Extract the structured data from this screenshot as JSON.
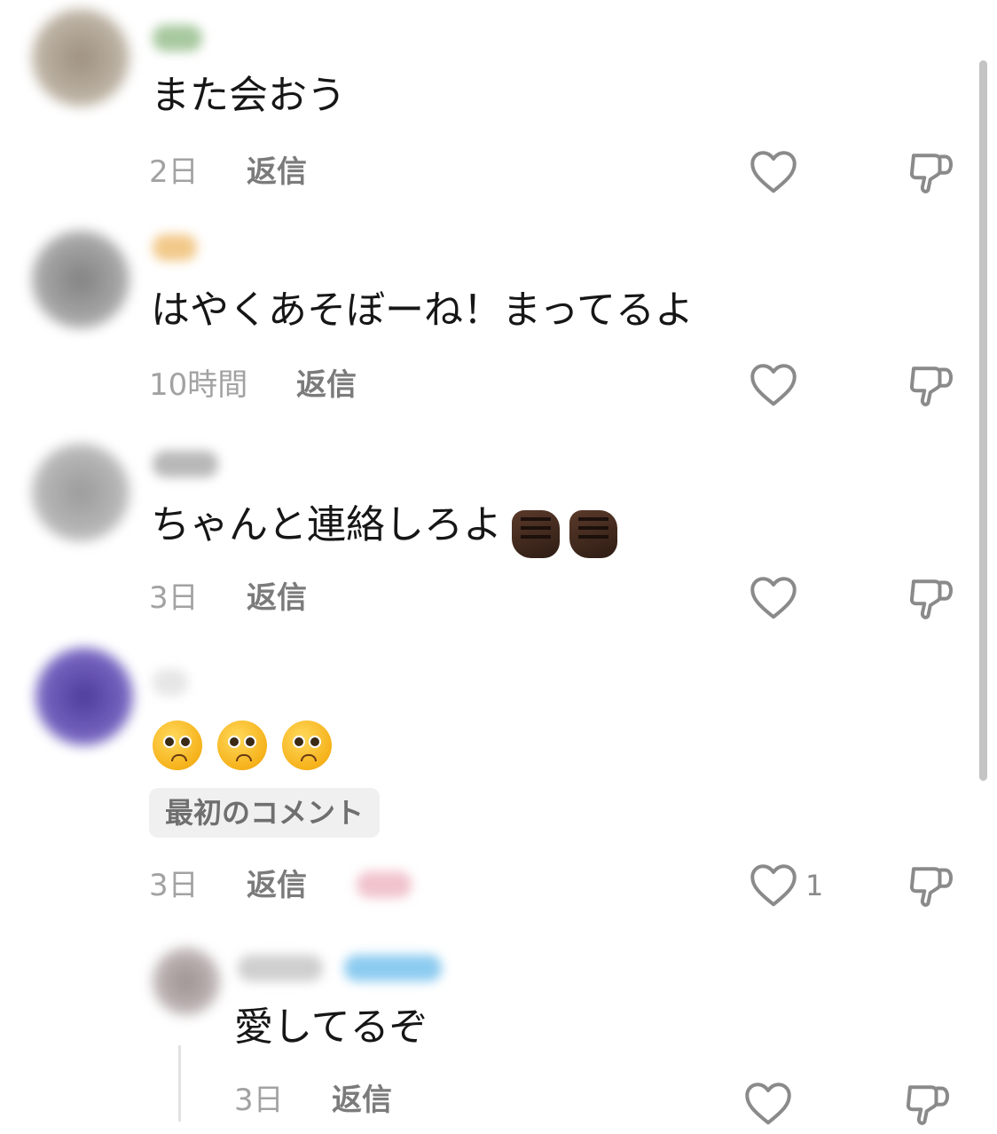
{
  "comments": [
    {
      "text": "また会おう",
      "time": "2日",
      "reply_label": "返信"
    },
    {
      "text": "はやくあそぼーね！まってるよ",
      "time": "10時間",
      "reply_label": "返信"
    },
    {
      "text": "ちゃんと連絡しろよ",
      "time": "3日",
      "reply_label": "返信"
    },
    {
      "text": "",
      "time": "3日",
      "reply_label": "返信",
      "badge": "最初のコメント",
      "like_count": "1"
    }
  ],
  "reply_comment": {
    "text": "愛してるぞ",
    "time": "3日",
    "reply_label": "返信"
  },
  "colors": {
    "heart_stroke": "#8a8a8a",
    "badge_bg": "#f0f0f0"
  },
  "icons": {
    "like": "heart-outline-icon",
    "dislike": "thumbs-down-icon"
  }
}
